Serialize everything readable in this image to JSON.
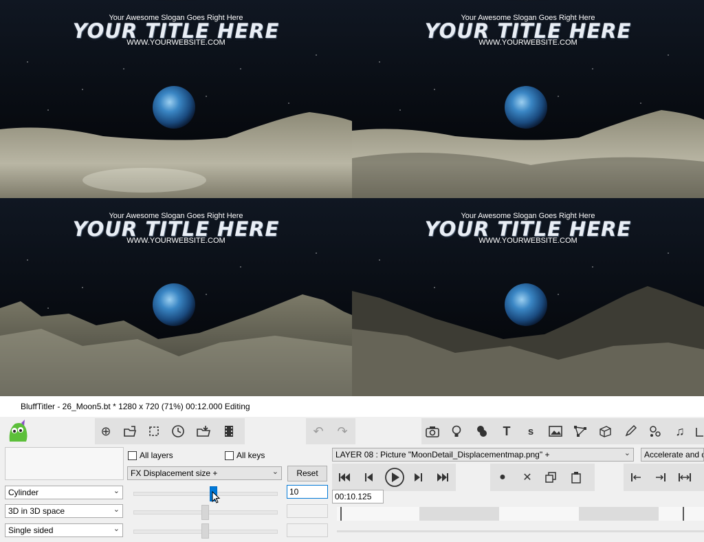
{
  "preview": {
    "panes": [
      {
        "slogan": "Your Awesome Slogan Goes Right Here",
        "title": "YOUR TITLE HERE",
        "website": "WWW.YOURWEBSITE.COM"
      },
      {
        "slogan": "Your Awesome Slogan Goes Right Here",
        "title": "YOUR TITLE HERE",
        "website": "WWW.YOURWEBSITE.COM"
      },
      {
        "slogan": "Your Awesome Slogan Goes Right Here",
        "title": "YOUR TITLE HERE",
        "website": "WWW.YOURWEBSITE.COM"
      },
      {
        "slogan": "Your Awesome Slogan Goes Right Here",
        "title": "YOUR TITLE HERE",
        "website": "WWW.YOURWEBSITE.COM"
      }
    ]
  },
  "window": {
    "title": "BluffTitler - 26_Moon5.bt * 1280 x 720 (71%) 00:12.000 Editing"
  },
  "toolbar": {
    "left_icons": [
      "add-icon",
      "open-folder-icon",
      "crop-icon",
      "clock-icon",
      "import-folder-icon",
      "film-icon"
    ],
    "undo_icons": [
      "undo-icon",
      "redo-icon"
    ],
    "layer_icons": [
      "camera-icon",
      "light-bulb-icon",
      "blob-icon",
      "text-icon",
      "s-icon",
      "picture-icon",
      "nodes-icon",
      "cube-icon",
      "pencil-icon",
      "particles-icon",
      "music-note-icon",
      "more-icon"
    ],
    "text_glyph": "T",
    "s_glyph": "s"
  },
  "controls": {
    "all_layers_label": "All layers",
    "all_keys_label": "All keys",
    "property_select": "FX Displacement size +",
    "reset_label": "Reset",
    "value_input": "10",
    "shape_select": "Cylinder",
    "space_select": "3D in 3D space",
    "sided_select": "Single sided",
    "slider_main_value": 0.56
  },
  "layer": {
    "select": "LAYER 08    : Picture \"MoonDetail_Displacementmap.png\" +",
    "easing_select": "Accelerate and de"
  },
  "playback": {
    "time": "00:10.125"
  }
}
